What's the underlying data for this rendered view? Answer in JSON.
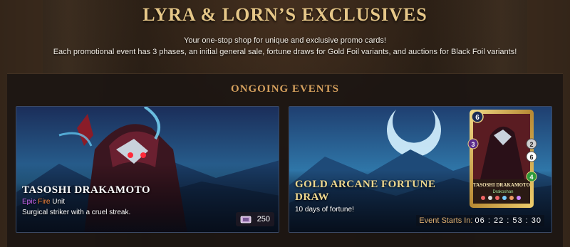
{
  "header": {
    "title": "LYRA & LORN’S EXCLUSIVES",
    "subtitle_line1": "Your one-stop shop for unique and exclusive promo cards!",
    "subtitle_line2": "Each promotional event has 3 phases, an initial general sale, fortune draws for Gold Foil variants, and auctions for Black Foil variants!"
  },
  "section": {
    "title": "ONGOING EVENTS"
  },
  "events": [
    {
      "name": "TASOSHI DRAKAMOTO",
      "rarity": "Epic",
      "element": "Fire",
      "type": "Unit",
      "description": "Surgical striker with a cruel streak.",
      "price": "250",
      "price_icon": "voucher-icon"
    },
    {
      "name": "GOLD ARCANE FORTUNE DRAW",
      "description": "10 days of fortune!",
      "countdown_label": "Event Starts In:",
      "countdown_value": "06 : 22 : 53 : 30",
      "card_preview": {
        "name": "TASOSHI DRAKAMOTO",
        "faction": "Drakoshan",
        "mana": "6",
        "attack": "3",
        "speed": "2",
        "armor": "6",
        "health": "4"
      }
    }
  ],
  "colors": {
    "title_gold": "#e6c788",
    "section_orange": "#d6a15e",
    "rarity_epic": "#d96bff",
    "element_fire": "#ff8a3d",
    "gold_title": "#f0d98f"
  }
}
